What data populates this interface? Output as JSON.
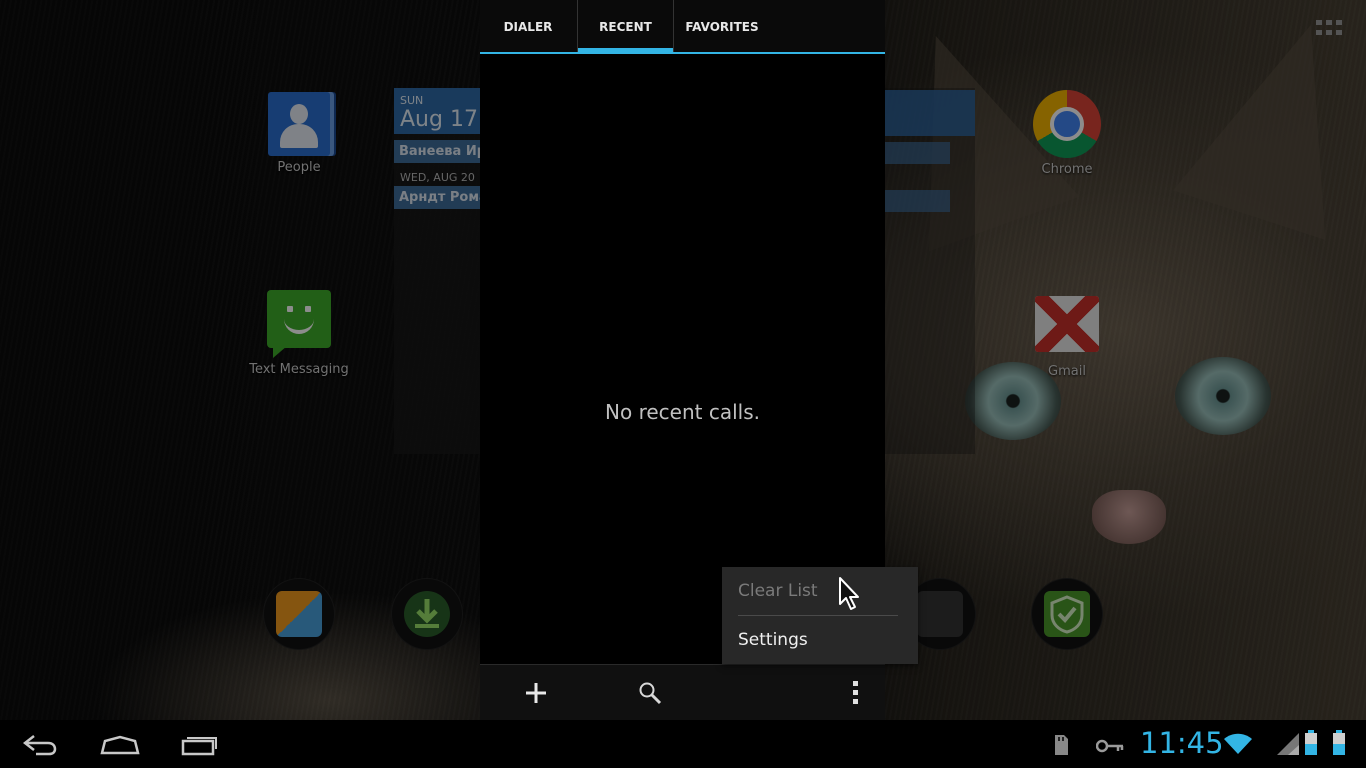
{
  "home": {
    "apps": [
      {
        "label": "People",
        "icon": "people-icon"
      },
      {
        "label": "Text Messaging",
        "icon": "text-messaging-icon"
      },
      {
        "label": "Chrome",
        "icon": "chrome-icon"
      },
      {
        "label": "Gmail",
        "icon": "gmail-icon"
      }
    ],
    "calendar_widget": {
      "day_of_week": "SUN",
      "date": "Aug 17",
      "events": [
        "Ванеева Ира",
        "Арндт Рома"
      ],
      "next_day": "WED, AUG 20"
    }
  },
  "phone_app": {
    "tabs": [
      {
        "label": "DIALER",
        "selected": false
      },
      {
        "label": "RECENT",
        "selected": true
      },
      {
        "label": "FAVORITES",
        "selected": false
      }
    ],
    "empty_message": "No recent calls.",
    "bottom_actions": [
      "add-contact-icon",
      "search-icon",
      "overflow-menu-icon"
    ]
  },
  "overflow_menu": {
    "items": [
      {
        "label": "Clear List",
        "enabled": false
      },
      {
        "label": "Settings",
        "enabled": true
      }
    ]
  },
  "system_bar": {
    "clock": "11:45",
    "nav_buttons": [
      "back-icon",
      "home-icon",
      "recent-apps-icon"
    ],
    "status_icons": [
      "sd-card-icon",
      "vpn-key-icon",
      "wifi-icon",
      "signal-icon",
      "battery-icon",
      "battery-icon"
    ],
    "accent_color": "#33b5e5"
  }
}
